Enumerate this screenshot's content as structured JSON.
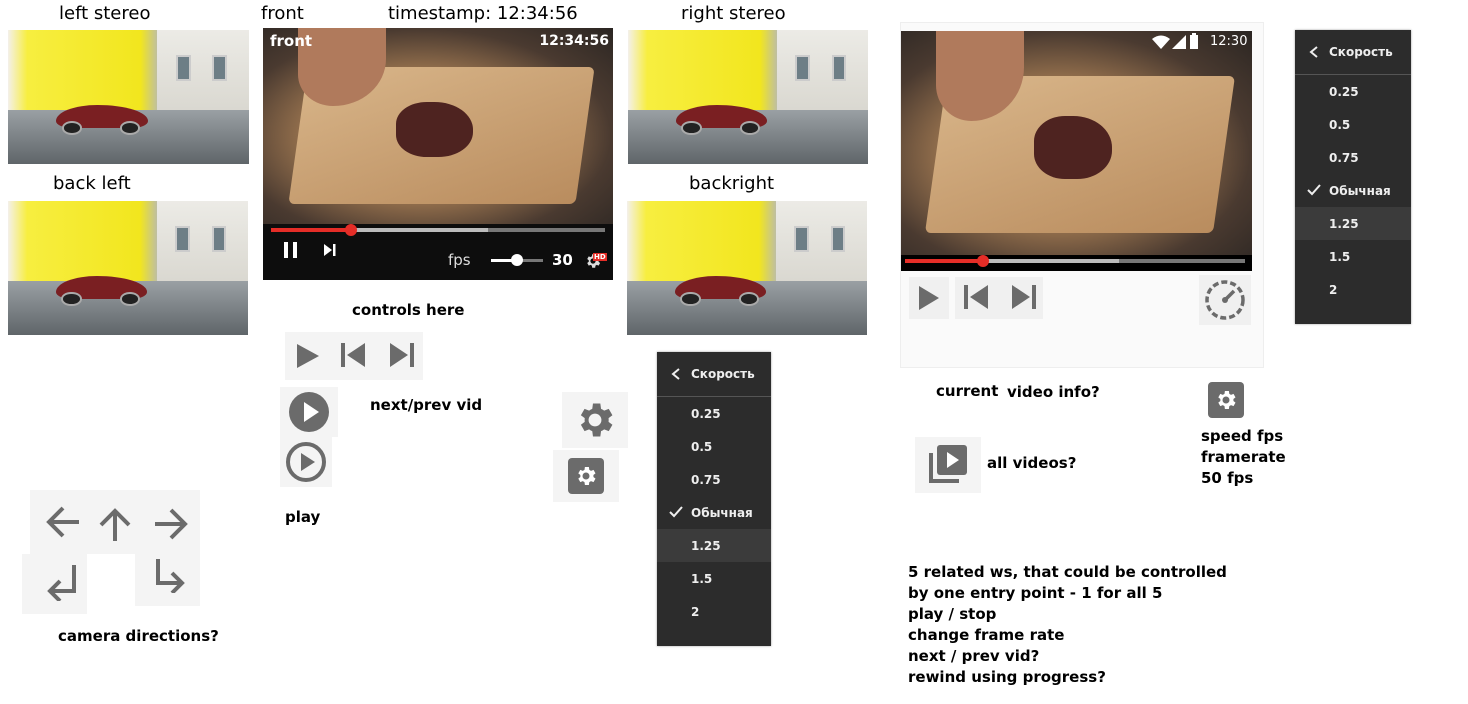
{
  "labels": {
    "left_stereo": "left stereo",
    "front": "front",
    "timestamp_label": "timestamp: 12:34:56",
    "right_stereo": "right stereo",
    "back_left": "back left",
    "backright": "backright",
    "controls_here": "controls here",
    "next_prev_vid": "next/prev vid",
    "play": "play",
    "camera_directions": "camera directions?",
    "current": "current",
    "video_info": "video info?",
    "all_videos": "all videos?",
    "speed_fps": "speed fps",
    "framerate": "framerate",
    "fps_50": "50 fps"
  },
  "front_player": {
    "overlay_title": "front",
    "overlay_time": "12:34:56",
    "fps_label": "fps",
    "fps_value": "30",
    "hd_badge": "HD",
    "progress": 0.24,
    "buffered": 0.65,
    "fps_slider": 0.5
  },
  "mobile_player": {
    "status_time": "12:30",
    "progress": 0.23,
    "buffered": 0.63
  },
  "speed_menu": {
    "title": "Скорость",
    "options": [
      "0.25",
      "0.5",
      "0.75",
      "Обычная",
      "1.25",
      "1.5",
      "2"
    ],
    "selected": "Обычная",
    "hovered": "1.25"
  },
  "notes": [
    "5 related ws, that could be controlled",
    "by one entry point - 1 for all 5",
    "play / stop",
    "change frame rate",
    "next / prev vid?",
    "rewind using progress?"
  ],
  "colors": {
    "progress": "#e52d27",
    "icon_gray": "#6b6b6b",
    "menu_bg": "#1c1c1c"
  },
  "icons": [
    "play-icon",
    "pause-icon",
    "skip-previous-icon",
    "skip-next-icon",
    "play-circle-icon",
    "play-circle-outline-icon",
    "gear-icon",
    "speedometer-icon",
    "video-library-icon",
    "arrow-left-icon",
    "arrow-up-icon",
    "arrow-right-icon",
    "turn-left-icon",
    "turn-right-icon",
    "chevron-left-icon",
    "check-icon",
    "wifi-icon",
    "signal-icon",
    "battery-icon"
  ]
}
